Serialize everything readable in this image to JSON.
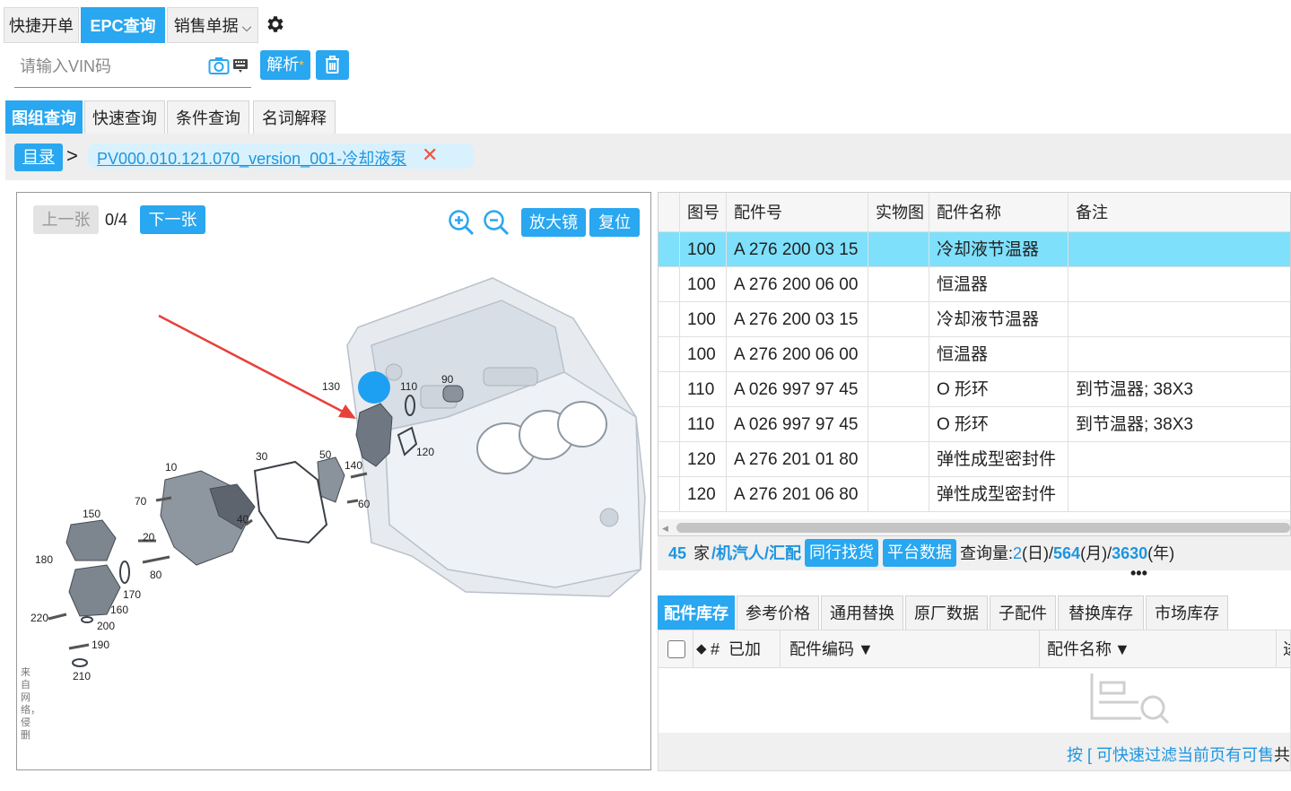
{
  "top_tabs": {
    "quick_order": "快捷开单",
    "epc_query": "EPC查询",
    "sales_docs": "销售单据"
  },
  "vin": {
    "placeholder": "请输入VIN码",
    "parse_label": "解析",
    "parse_mark": "*"
  },
  "section_tabs": [
    "图组查询",
    "快速查询",
    "条件查询",
    "名词解释"
  ],
  "breadcrumb": {
    "root": "目录",
    "current": "PV000.010.121.070_version_001-冷却液泵"
  },
  "viewer": {
    "prev_label": "上一张",
    "counter": "0/4",
    "next_label": "下一张",
    "magnifier_label": "放大镜",
    "reset_label": "复位",
    "watermark": "来自网络，侵删",
    "callouts": [
      "130",
      "110",
      "90",
      "120",
      "140",
      "60",
      "50",
      "30",
      "10",
      "70",
      "40",
      "20",
      "80",
      "150",
      "180",
      "170",
      "160",
      "220",
      "200",
      "190",
      "210"
    ]
  },
  "parts_table": {
    "headers": [
      "图号",
      "配件号",
      "实物图",
      "配件名称",
      "备注"
    ],
    "rows": [
      {
        "fig": "100",
        "part_no": "A 276 200 03 15",
        "photo": "",
        "name": "冷却液节温器",
        "note": "",
        "selected": true
      },
      {
        "fig": "100",
        "part_no": "A 276 200 06 00",
        "photo": "",
        "name": "恒温器",
        "note": ""
      },
      {
        "fig": "100",
        "part_no": "A 276 200 03 15",
        "photo": "",
        "name": "冷却液节温器",
        "note": ""
      },
      {
        "fig": "100",
        "part_no": "A 276 200 06 00",
        "photo": "",
        "name": "恒温器",
        "note": ""
      },
      {
        "fig": "110",
        "part_no": "A 026 997 97 45",
        "photo": "",
        "name": "O 形环",
        "note": "到节温器; 38X3"
      },
      {
        "fig": "110",
        "part_no": "A 026 997 97 45",
        "photo": "",
        "name": "O 形环",
        "note": "到节温器; 38X3"
      },
      {
        "fig": "120",
        "part_no": "A 276 201 01 80",
        "photo": "",
        "name": "弹性成型密封件",
        "note": ""
      },
      {
        "fig": "120",
        "part_no": "A 276 201 06 80",
        "photo": "",
        "name": "弹性成型密封件",
        "note": ""
      }
    ]
  },
  "stats": {
    "count": "45",
    "unit": "家",
    "groups": "/机汽人/汇配",
    "peer_btn": "同行找货",
    "platform_btn": "平台数据",
    "query_label": "查询量:",
    "day": "2",
    "day_unit": "(日)/",
    "month": "564",
    "month_unit": "(月)/",
    "year": "3630",
    "year_unit": "(年)"
  },
  "lower_tabs": [
    "配件库存",
    "参考价格",
    "通用替换",
    "原厂数据",
    "子配件",
    "替换库存",
    "市场库存"
  ],
  "stock_table": {
    "hash": "#",
    "added": "已加",
    "code": "配件编码",
    "name": "配件名称",
    "cut_col": "进"
  },
  "footer_hint": "按 [ 可快速过滤当前页有可售",
  "footer_hint_tail": "共",
  "colors": {
    "accent": "#29a7f0",
    "selected_row": "#7ee0fb",
    "arrow": "#e8403a"
  }
}
